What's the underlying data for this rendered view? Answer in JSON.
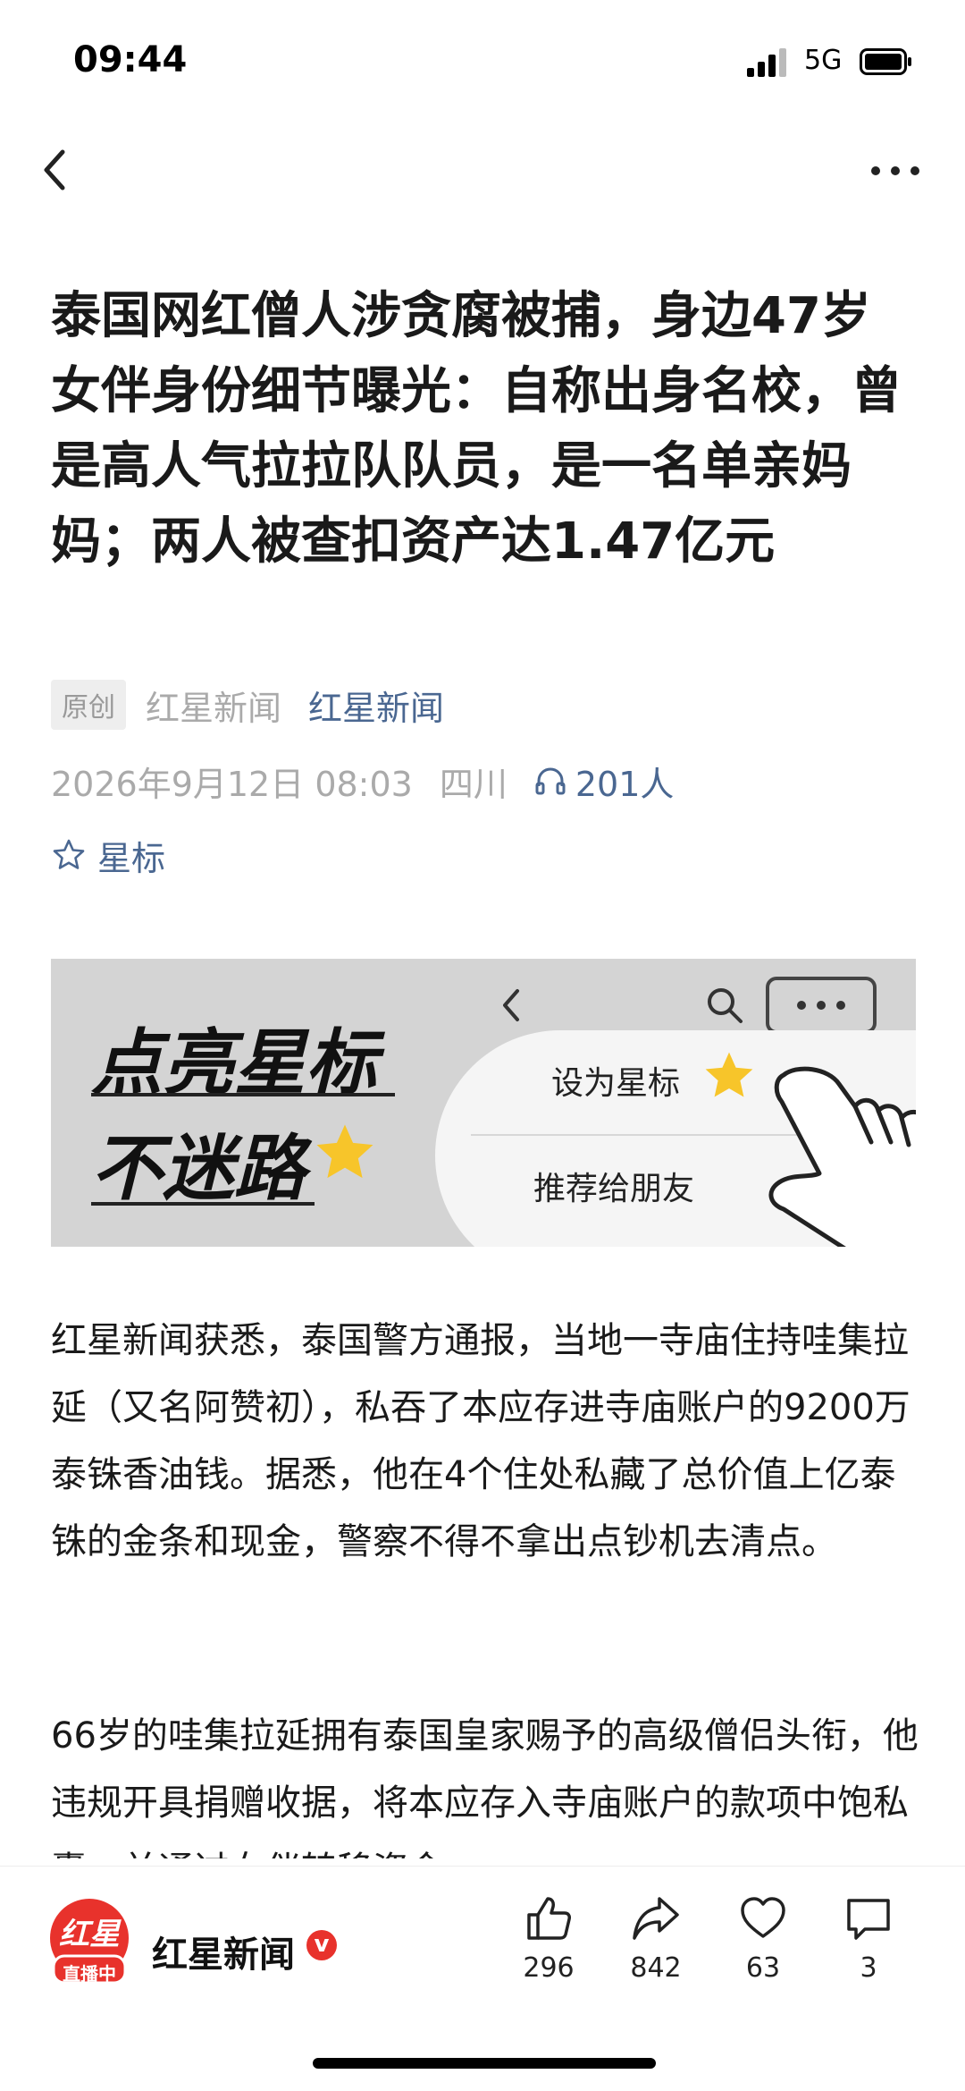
{
  "status_bar": {
    "time": "09:44",
    "network": "5G"
  },
  "article": {
    "title": "泰国网红僧人涉贪腐被捕，身边47岁女伴身份细节曝光：自称出身名校，曾是高人气拉拉队队员，是一名单亲妈妈；两人被查扣资产达1.47亿元",
    "original_badge": "原创",
    "source_name": "红星新闻",
    "source_link": "红星新闻",
    "date": "2026年9月12日 08:03",
    "location": "四川",
    "listen_count": "201人",
    "star_label": "星标",
    "paragraphs": [
      "红星新闻获悉，泰国警方通报，当地一寺庙住持哇集拉延（又名阿赞初），私吞了本应存进寺庙账户的9200万泰铢香油钱。据悉，他在4个住处私藏了总价值上亿泰铢的金条和现金，警察不得不拿出点钞机去清点。",
      "66岁的哇集拉延拥有泰国皇家赐予的高级僧侣头衔，他违规开具捐赠收据，将本应存入寺庙账户的款项中饱私囊，并通过女伴转移资金。"
    ]
  },
  "banner": {
    "line1": "点亮星标",
    "line2": "不迷路",
    "menu_item_1": "设为星标",
    "menu_item_2": "推荐给朋友"
  },
  "bottom_bar": {
    "avatar_text": "红星",
    "avatar_live": "直播中",
    "account_name": "红星新闻",
    "verified_mark": "v",
    "like_count": "296",
    "share_count": "842",
    "favorite_count": "63",
    "comment_count": "3"
  },
  "colors": {
    "accent": "#4a6791",
    "brand": "#e8322c"
  }
}
